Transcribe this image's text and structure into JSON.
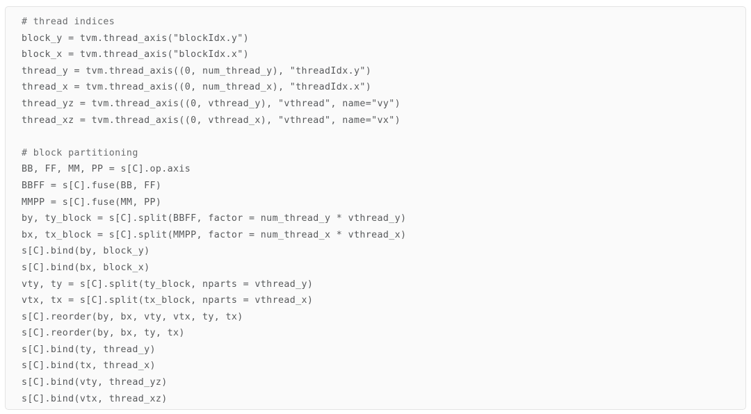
{
  "code_block": {
    "language": "python",
    "background_color": "#fafafa",
    "border_color": "#e3e3e3",
    "text_color": "#57595b",
    "comment_color": "#6a6c6e",
    "lines": [
      "# thread indices",
      "block_y = tvm.thread_axis(\"blockIdx.y\")",
      "block_x = tvm.thread_axis(\"blockIdx.x\")",
      "thread_y = tvm.thread_axis((0, num_thread_y), \"threadIdx.y\")",
      "thread_x = tvm.thread_axis((0, num_thread_x), \"threadIdx.x\")",
      "thread_yz = tvm.thread_axis((0, vthread_y), \"vthread\", name=\"vy\")",
      "thread_xz = tvm.thread_axis((0, vthread_x), \"vthread\", name=\"vx\")",
      "",
      "# block partitioning",
      "BB, FF, MM, PP = s[C].op.axis",
      "BBFF = s[C].fuse(BB, FF)",
      "MMPP = s[C].fuse(MM, PP)",
      "by, ty_block = s[C].split(BBFF, factor = num_thread_y * vthread_y)",
      "bx, tx_block = s[C].split(MMPP, factor = num_thread_x * vthread_x)",
      "s[C].bind(by, block_y)",
      "s[C].bind(bx, block_x)",
      "vty, ty = s[C].split(ty_block, nparts = vthread_y)",
      "vtx, tx = s[C].split(tx_block, nparts = vthread_x)",
      "s[C].reorder(by, bx, vty, vtx, ty, tx)",
      "s[C].reorder(by, bx, ty, tx)",
      "s[C].bind(ty, thread_y)",
      "s[C].bind(tx, thread_x)",
      "s[C].bind(vty, thread_yz)",
      "s[C].bind(vtx, thread_xz)"
    ]
  }
}
